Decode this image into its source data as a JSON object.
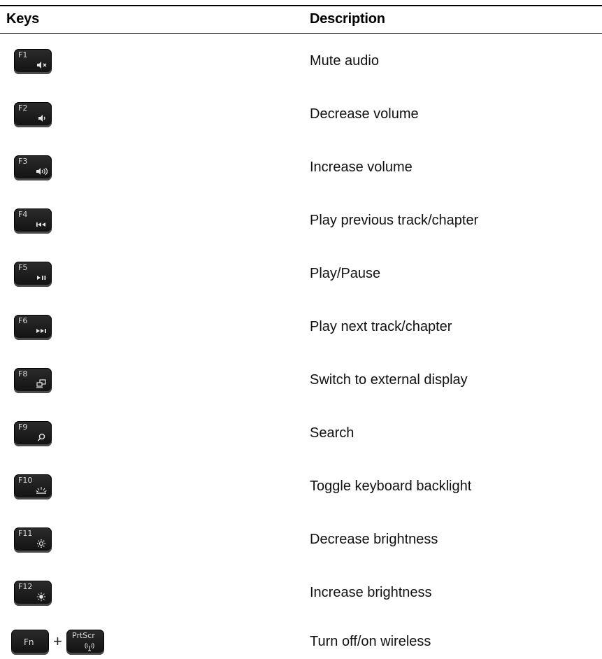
{
  "header": {
    "keys": "Keys",
    "description": "Description"
  },
  "rows": [
    {
      "key": "F1",
      "icon": "mute-icon",
      "description": "Mute audio"
    },
    {
      "key": "F2",
      "icon": "volume-down-icon",
      "description": "Decrease volume"
    },
    {
      "key": "F3",
      "icon": "volume-up-icon",
      "description": "Increase volume"
    },
    {
      "key": "F4",
      "icon": "previous-track-icon",
      "description": "Play previous track/chapter"
    },
    {
      "key": "F5",
      "icon": "play-pause-icon",
      "description": "Play/Pause"
    },
    {
      "key": "F6",
      "icon": "next-track-icon",
      "description": "Play next track/chapter"
    },
    {
      "key": "F8",
      "icon": "external-display-icon",
      "description": "Switch to external display"
    },
    {
      "key": "F9",
      "icon": "search-icon",
      "description": "Search"
    },
    {
      "key": "F10",
      "icon": "keyboard-backlight-icon",
      "description": "Toggle keyboard backlight"
    },
    {
      "key": "F11",
      "icon": "brightness-down-icon",
      "description": "Decrease brightness"
    },
    {
      "key": "F12",
      "icon": "brightness-up-icon",
      "description": "Increase brightness"
    }
  ],
  "combo": {
    "key1": "Fn",
    "plus": "+",
    "key2": "PrtScr",
    "key2_icon": "wireless-icon",
    "description": "Turn off/on wireless"
  }
}
